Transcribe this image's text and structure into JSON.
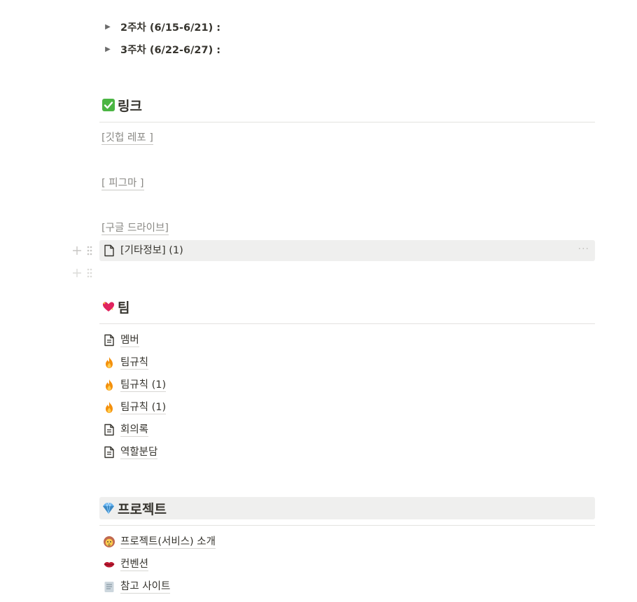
{
  "toggles": [
    {
      "label": "2주차 (6/15-6/21) :"
    },
    {
      "label": "3주차 (6/22-6/27) :"
    }
  ],
  "sections": {
    "links": {
      "emoji": "check-mark-button-icon",
      "title": "링크",
      "items": [
        {
          "label": "[깃헙 레포 ]"
        },
        {
          "label": "[ 피그마 ]"
        },
        {
          "label": "[구글 드라이브]"
        }
      ],
      "page_item": {
        "label": "[기타정보] (1)",
        "icon": "page-icon"
      }
    },
    "team": {
      "emoji": "sparkling-heart-icon",
      "title": "팀",
      "items": [
        {
          "label": "멤버",
          "icon": "page-icon"
        },
        {
          "label": "팀규칙",
          "icon": "fire-icon"
        },
        {
          "label": "팀규칙 (1)",
          "icon": "fire-icon"
        },
        {
          "label": "팀규칙 (1)",
          "icon": "fire-icon"
        },
        {
          "label": "회의록",
          "icon": "page-icon"
        },
        {
          "label": "역할분담",
          "icon": "page-icon"
        }
      ]
    },
    "project": {
      "emoji": "gem-stone-icon",
      "title": "프로젝트",
      "items": [
        {
          "label": "프로젝트(서비스) 소개",
          "icon": "lion-icon"
        },
        {
          "label": "컨벤션",
          "icon": "lips-icon"
        },
        {
          "label": "참고 사이트",
          "icon": "memo-icon"
        }
      ]
    }
  },
  "colors": {
    "text": "#37352f",
    "muted": "#8a8985",
    "hover_bg": "#efefee",
    "rule": "#e3e2e0"
  }
}
